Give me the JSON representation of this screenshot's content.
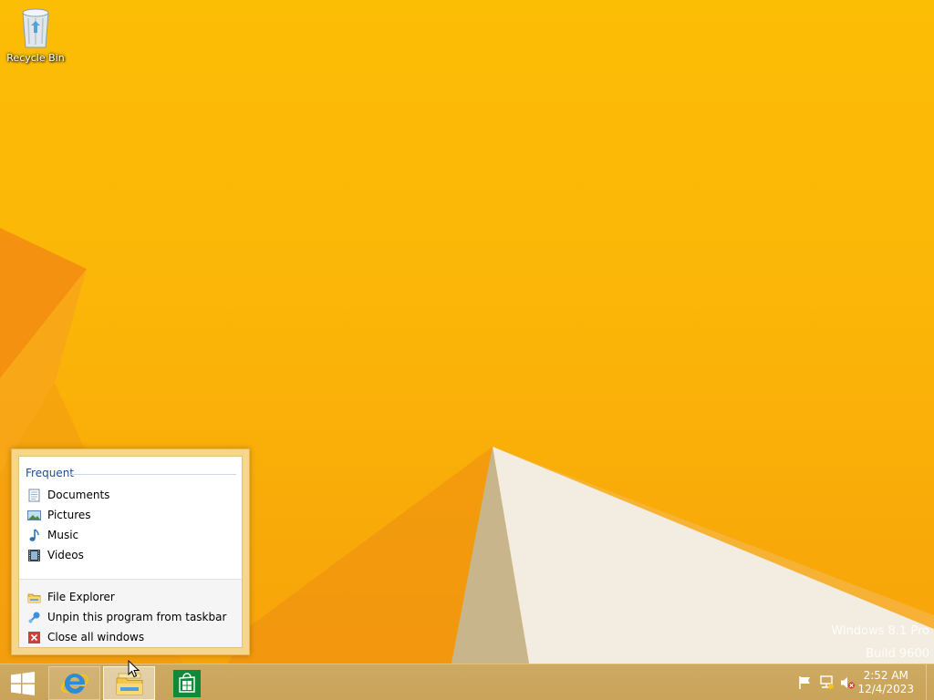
{
  "desktop": {
    "icons": [
      {
        "label": "Recycle Bin",
        "icon": "recycle-bin-icon"
      }
    ],
    "watermark": {
      "line1": "Windows 8.1 Pro",
      "line2": "Build 9600"
    }
  },
  "jumplist": {
    "heading": "Frequent",
    "frequent": [
      {
        "label": "Documents",
        "icon": "documents-icon"
      },
      {
        "label": "Pictures",
        "icon": "pictures-icon"
      },
      {
        "label": "Music",
        "icon": "music-icon"
      },
      {
        "label": "Videos",
        "icon": "videos-icon"
      }
    ],
    "tasks": [
      {
        "label": "File Explorer",
        "icon": "folder-icon"
      },
      {
        "label": "Unpin this program from taskbar",
        "icon": "unpin-icon"
      },
      {
        "label": "Close all windows",
        "icon": "close-icon"
      }
    ]
  },
  "taskbar": {
    "pinned": [
      {
        "name": "Internet Explorer",
        "icon": "internet-explorer-icon"
      },
      {
        "name": "File Explorer",
        "icon": "file-explorer-icon",
        "active": true
      },
      {
        "name": "Store",
        "icon": "store-icon"
      }
    ],
    "tray": [
      "action-center-flag-icon",
      "network-icon",
      "volume-muted-icon"
    ],
    "clock": {
      "time": "2:52 AM",
      "date": "12/4/2023"
    }
  },
  "colors": {
    "wallpaper": "#fbb607",
    "taskbar": "#c9a35a",
    "accent": "#1e4e8c"
  }
}
